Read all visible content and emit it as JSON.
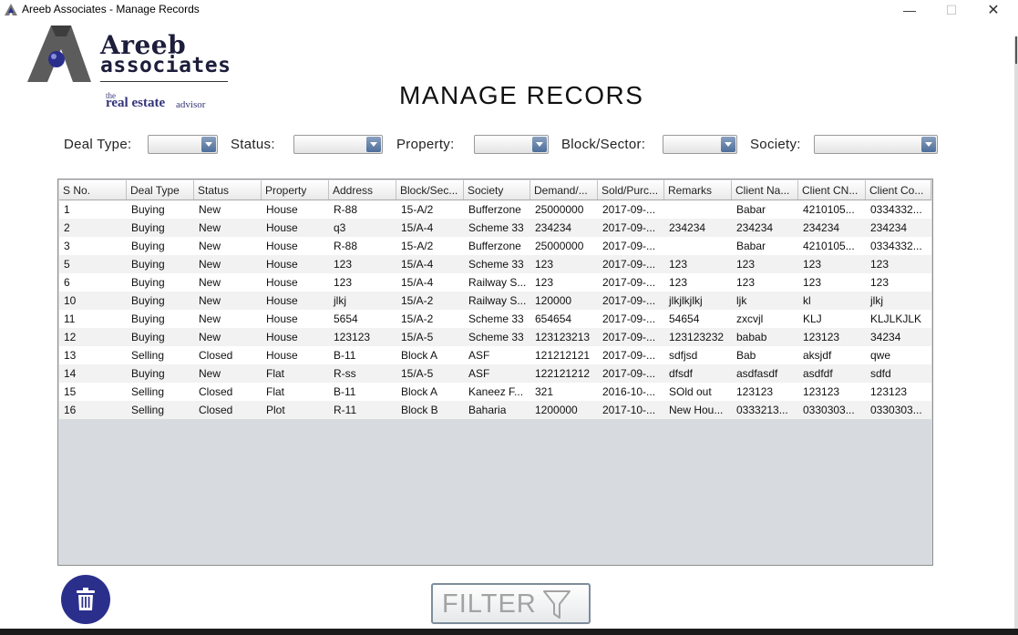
{
  "window": {
    "title": "Areeb Associates - Manage Records",
    "controls": {
      "minimize": "—",
      "maximize": "☐",
      "close": "✕"
    }
  },
  "logo": {
    "name": "Areeb",
    "sub": "associates",
    "tag_the": "the",
    "tag_main": "real estate",
    "tag_end": "advisor"
  },
  "page_title": "MANAGE RECORS",
  "filters": [
    {
      "label": "Deal Type:",
      "value": ""
    },
    {
      "label": "Status:",
      "value": ""
    },
    {
      "label": "Property:",
      "value": ""
    },
    {
      "label": "Block/Sector:",
      "value": ""
    },
    {
      "label": "Society:",
      "value": ""
    }
  ],
  "table": {
    "columns": [
      "S No.",
      "Deal Type",
      "Status",
      "Property",
      "Address",
      "Block/Sec...",
      "Society",
      "Demand/...",
      "Sold/Purc...",
      "Remarks",
      "Client Na...",
      "Client CN...",
      "Client Co..."
    ],
    "rows": [
      [
        "1",
        "Buying",
        "New",
        "House",
        "R-88",
        "15-A/2",
        "Bufferzone",
        "25000000",
        "2017-09-...",
        "",
        "Babar",
        "4210105...",
        "0334332..."
      ],
      [
        "2",
        "Buying",
        "New",
        "House",
        "q3",
        "15/A-4",
        "Scheme 33",
        "234234",
        "2017-09-...",
        "234234",
        "234234",
        "234234",
        "234234"
      ],
      [
        "3",
        "Buying",
        "New",
        "House",
        "R-88",
        "15-A/2",
        "Bufferzone",
        "25000000",
        "2017-09-...",
        "",
        "Babar",
        "4210105...",
        "0334332..."
      ],
      [
        "5",
        "Buying",
        "New",
        "House",
        "123",
        "15/A-4",
        "Scheme 33",
        "123",
        "2017-09-...",
        "123",
        "123",
        "123",
        "123"
      ],
      [
        "6",
        "Buying",
        "New",
        "House",
        "123",
        "15/A-4",
        "Railway S...",
        "123",
        "2017-09-...",
        "123",
        "123",
        "123",
        "123"
      ],
      [
        "10",
        "Buying",
        "New",
        "House",
        "jlkj",
        "15/A-2",
        "Railway S...",
        "120000",
        "2017-09-...",
        "jlkjlkjlkj",
        "ljk",
        "kl",
        "jlkj"
      ],
      [
        "11",
        "Buying",
        "New",
        "House",
        "5654",
        "15/A-2",
        "Scheme 33",
        "654654",
        "2017-09-...",
        "54654",
        "zxcvjl",
        "KLJ",
        "KLJLKJLK"
      ],
      [
        "12",
        "Buying",
        "New",
        "House",
        "123123",
        "15/A-5",
        "Scheme 33",
        "123123213",
        "2017-09-...",
        "123123232",
        "babab",
        "123123",
        "34234"
      ],
      [
        "13",
        "Selling",
        "Closed",
        "House",
        "B-11",
        "Block A",
        "ASF",
        "121212121",
        "2017-09-...",
        "sdfjsd",
        "Bab",
        "aksjdf",
        "qwe"
      ],
      [
        "14",
        "Buying",
        "New",
        "Flat",
        "R-ss",
        "15/A-5",
        "ASF",
        "122121212",
        "2017-09-...",
        "dfsdf",
        "asdfasdf",
        "asdfdf",
        "sdfd"
      ],
      [
        "15",
        "Selling",
        "Closed",
        "Flat",
        "B-11",
        "Block A",
        "Kaneez F...",
        "321",
        "2016-10-...",
        "SOld out",
        "123123",
        "123123",
        "123123"
      ],
      [
        "16",
        "Selling",
        "Closed",
        "Plot",
        "R-11",
        "Block B",
        "Baharia",
        "1200000",
        "2017-10-...",
        "New Hou...",
        "0333213...",
        "0330303...",
        "0330303..."
      ]
    ]
  },
  "buttons": {
    "delete_icon": "trash-icon",
    "filter_label": "FILTER",
    "filter_icon": "funnel-icon"
  },
  "colors": {
    "brand_blue": "#2b2f8c",
    "combo_arrow": "#5a7aa6",
    "table_bg": "#d7dbdf"
  }
}
